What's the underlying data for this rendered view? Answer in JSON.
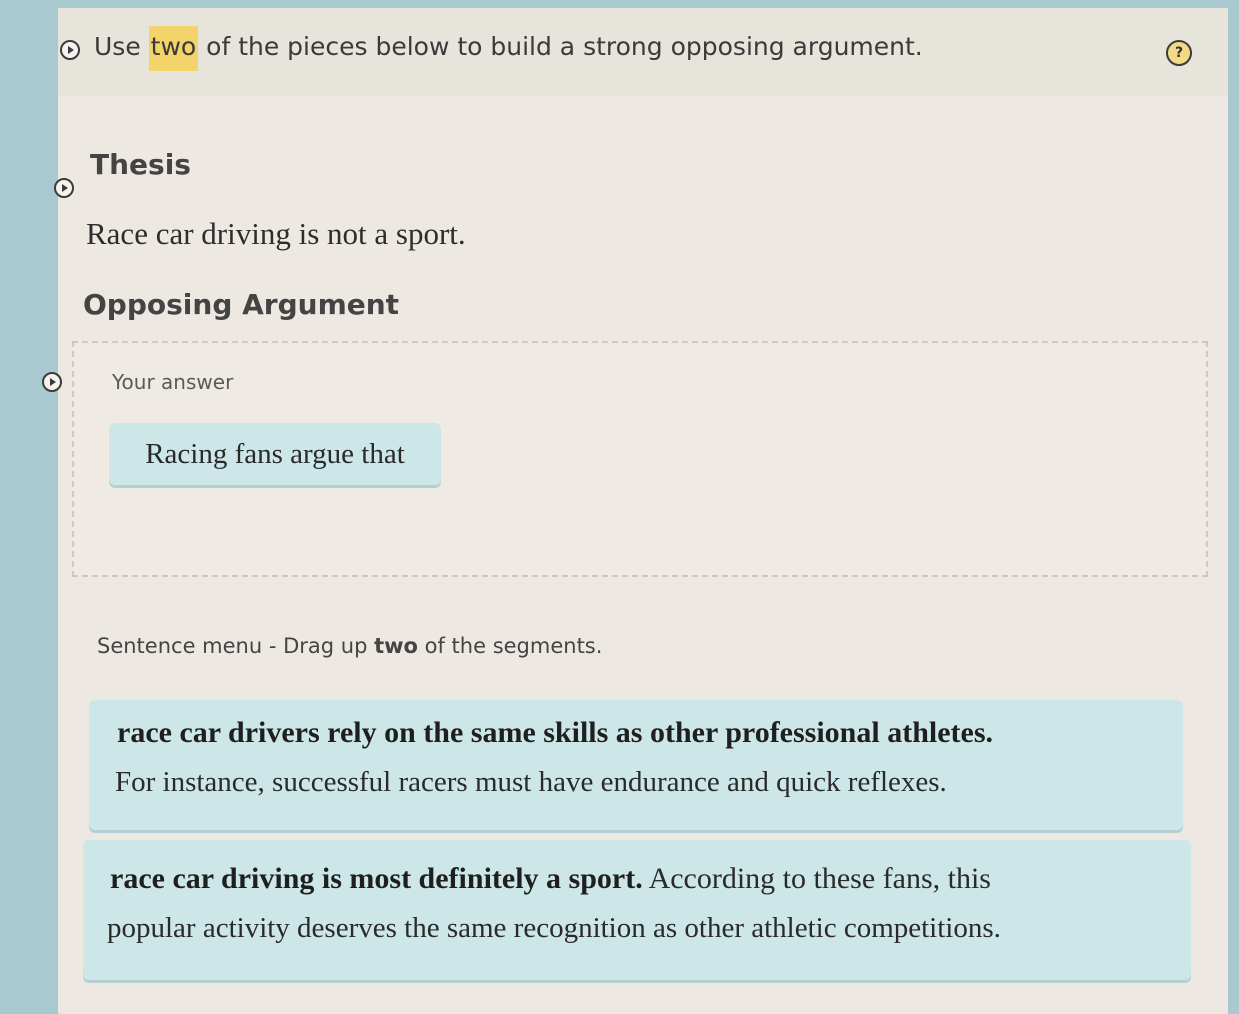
{
  "instruction": {
    "text_before": "Use ",
    "highlight": "two",
    "text_after": " of the pieces below to build a strong opposing argument."
  },
  "icons": {
    "play": "play-circle-icon",
    "help": "help-icon"
  },
  "help_label": "?",
  "thesis": {
    "heading": "Thesis",
    "text": "Race car driving is not a sport."
  },
  "opposing": {
    "heading": "Opposing Argument",
    "answer_label": "Your answer",
    "answer_chip": "Racing fans argue that"
  },
  "sentence_menu": {
    "label_before": "Sentence menu - Drag up ",
    "label_bold": "two",
    "label_after": " of the segments.",
    "segments": [
      {
        "line1_bold": "race car drivers rely on the same skills as other professional athletes.",
        "line1_rest": "",
        "line2": "For instance, successful racers must have endurance and quick reflexes."
      },
      {
        "line1_bold": "race car driving is most definitely a sport.",
        "line1_rest": " According to these fans, this",
        "line2": "popular activity deserves the same recognition as other athletic competitions."
      }
    ]
  },
  "colors": {
    "highlight": "#f2d46a",
    "chip": "#cde7e9",
    "panel": "#ede9e2",
    "background": "#a9c9d0"
  }
}
